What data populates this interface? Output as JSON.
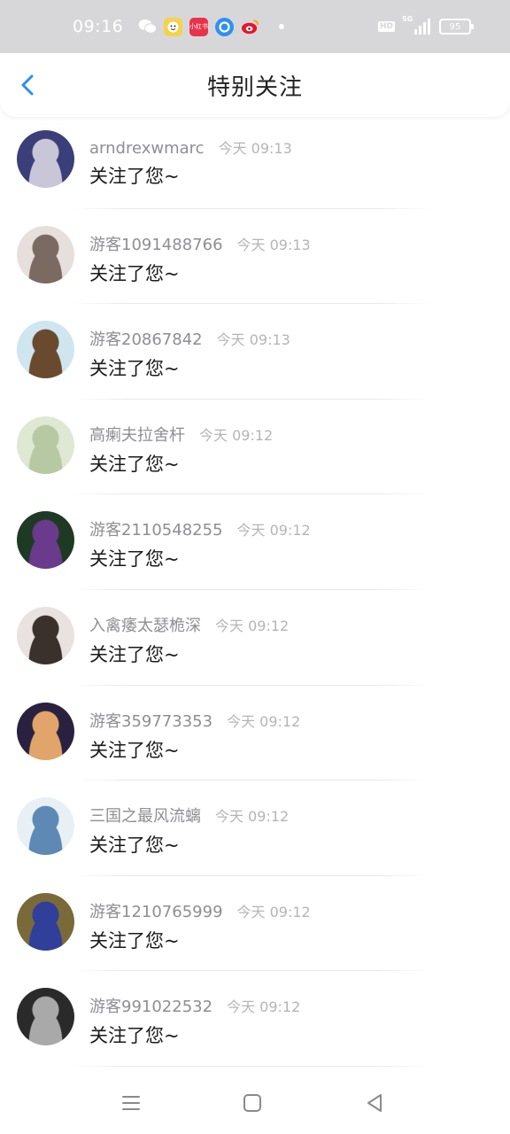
{
  "status_bar": {
    "time": "09:16",
    "notification_icons": [
      "wechat-icon",
      "face-app-icon",
      "xiaohongshu-icon",
      "browser-icon",
      "weibo-icon"
    ],
    "red_app_label": "小红书",
    "hd": "HD",
    "network": "5G",
    "battery": "95"
  },
  "nav": {
    "title": "特别关注"
  },
  "list": [
    {
      "name": "arndrexwmarc",
      "time": "今天 09:13",
      "message": "关注了您~",
      "avatar_colors": [
        "#3a3f7a",
        "#c9c6d8"
      ]
    },
    {
      "name": "游客1091488766",
      "time": "今天 09:13",
      "message": "关注了您~",
      "avatar_colors": [
        "#e6dfdc",
        "#7a6a62"
      ]
    },
    {
      "name": "游客20867842",
      "time": "今天 09:13",
      "message": "关注了您~",
      "avatar_colors": [
        "#cfe6f0",
        "#6a4a2e"
      ]
    },
    {
      "name": "高瘌夫拉舍杆",
      "time": "今天 09:12",
      "message": "关注了您~",
      "avatar_colors": [
        "#dfe8d2",
        "#b7c9a2"
      ]
    },
    {
      "name": "游客2110548255",
      "time": "今天 09:12",
      "message": "关注了您~",
      "avatar_colors": [
        "#1f3a24",
        "#6a3a8c"
      ]
    },
    {
      "name": "入禽痿太瑟桅深",
      "time": "今天 09:12",
      "message": "关注了您~",
      "avatar_colors": [
        "#e9e2df",
        "#3a302c"
      ]
    },
    {
      "name": "游客359773353",
      "time": "今天 09:12",
      "message": "关注了您~",
      "avatar_colors": [
        "#2a2140",
        "#e1a46a"
      ]
    },
    {
      "name": "三国之最风流螭",
      "time": "今天 09:12",
      "message": "关注了您~",
      "avatar_colors": [
        "#e8f0f6",
        "#5d89b4"
      ]
    },
    {
      "name": "游客1210765999",
      "time": "今天 09:12",
      "message": "关注了您~",
      "avatar_colors": [
        "#7a6a3a",
        "#2f3f9a"
      ]
    },
    {
      "name": "游客991022532",
      "time": "今天 09:12",
      "message": "关注了您~",
      "avatar_colors": [
        "#2a2a2a",
        "#a9a9a9"
      ]
    }
  ],
  "bottom_nav": [
    "menu-icon",
    "home-icon",
    "back-triangle-icon"
  ],
  "accent_color": "#2b8ef0"
}
